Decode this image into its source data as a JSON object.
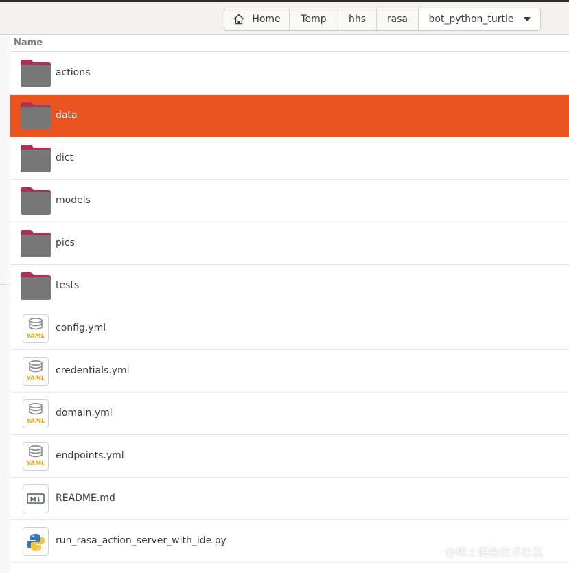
{
  "breadcrumbs": [
    {
      "label": "Home",
      "icon": "home-icon"
    },
    {
      "label": "Temp"
    },
    {
      "label": "hhs"
    },
    {
      "label": "rasa"
    },
    {
      "label": "bot_python_turtle",
      "icon": "chevron-down-icon"
    }
  ],
  "column_header": "Name",
  "files": [
    {
      "name": "actions",
      "type": "folder"
    },
    {
      "name": "data",
      "type": "folder",
      "selected": true
    },
    {
      "name": "dict",
      "type": "folder"
    },
    {
      "name": "models",
      "type": "folder"
    },
    {
      "name": "pics",
      "type": "folder"
    },
    {
      "name": "tests",
      "type": "folder"
    },
    {
      "name": "config.yml",
      "type": "yaml"
    },
    {
      "name": "credentials.yml",
      "type": "yaml"
    },
    {
      "name": "domain.yml",
      "type": "yaml"
    },
    {
      "name": "endpoints.yml",
      "type": "yaml"
    },
    {
      "name": "README.md",
      "type": "markdown"
    },
    {
      "name": "run_rasa_action_server_with_ide.py",
      "type": "python"
    }
  ],
  "icon_labels": {
    "yaml": "YAML",
    "markdown": "M↓"
  },
  "watermark": "@稀土掘金技术社区",
  "colors": {
    "selection": "#e95420",
    "folder_tab": "#b03052",
    "folder_body": "#777777",
    "yaml_text": "#f5a623"
  }
}
